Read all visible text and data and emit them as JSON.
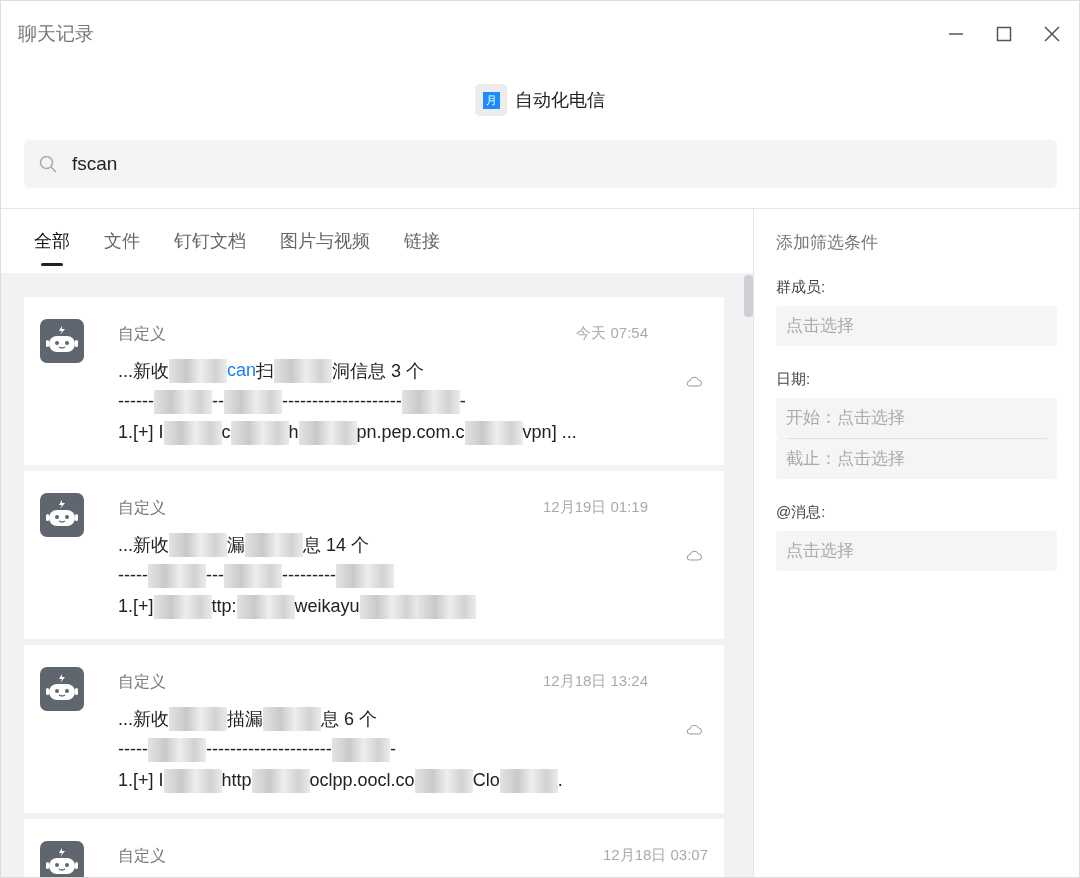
{
  "window": {
    "title": "聊天记录"
  },
  "chat": {
    "name": "自动化电信",
    "avatar_text": "月"
  },
  "search": {
    "value": "fscan"
  },
  "tabs": [
    {
      "label": "全部",
      "selected": true
    },
    {
      "label": "文件",
      "selected": false
    },
    {
      "label": "钉钉文档",
      "selected": false
    },
    {
      "label": "图片与视频",
      "selected": false
    },
    {
      "label": "链接",
      "selected": false
    }
  ],
  "results": [
    {
      "sender": "自定义",
      "time": "今天 07:54",
      "lines": [
        [
          {
            "kind": "text",
            "text": "...新收"
          },
          {
            "kind": "redacted"
          },
          {
            "kind": "match",
            "text": "can"
          },
          {
            "kind": "text",
            "text": "扫"
          },
          {
            "kind": "redacted"
          },
          {
            "kind": "text",
            "text": "洞信息 3 个"
          }
        ],
        [
          {
            "kind": "text",
            "text": "------"
          },
          {
            "kind": "redacted"
          },
          {
            "kind": "text",
            "text": "--"
          },
          {
            "kind": "redacted"
          },
          {
            "kind": "text",
            "text": "--------------------"
          },
          {
            "kind": "redacted"
          },
          {
            "kind": "text",
            "text": "-"
          }
        ],
        [
          {
            "kind": "text",
            "text": "1.[+] I"
          },
          {
            "kind": "redacted"
          },
          {
            "kind": "text",
            "text": "c"
          },
          {
            "kind": "redacted"
          },
          {
            "kind": "text",
            "text": "h"
          },
          {
            "kind": "redacted"
          },
          {
            "kind": "text",
            "text": "pn.pep.com.c"
          },
          {
            "kind": "redacted"
          },
          {
            "kind": "text",
            "text": "vpn] ..."
          }
        ]
      ]
    },
    {
      "sender": "自定义",
      "time": "12月19日 01:19",
      "lines": [
        [
          {
            "kind": "text",
            "text": "...新收"
          },
          {
            "kind": "redacted"
          },
          {
            "kind": "text",
            "text": "漏"
          },
          {
            "kind": "redacted"
          },
          {
            "kind": "text",
            "text": "息 14 个"
          }
        ],
        [
          {
            "kind": "text",
            "text": "-----"
          },
          {
            "kind": "redacted"
          },
          {
            "kind": "text",
            "text": "---"
          },
          {
            "kind": "redacted"
          },
          {
            "kind": "text",
            "text": "---------"
          },
          {
            "kind": "redacted"
          }
        ],
        [
          {
            "kind": "text",
            "text": "1.[+] "
          },
          {
            "kind": "redacted"
          },
          {
            "kind": "text",
            "text": "ttp:"
          },
          {
            "kind": "redacted"
          },
          {
            "kind": "text",
            "text": "weikayu"
          },
          {
            "kind": "redacted"
          },
          {
            "kind": "redacted"
          }
        ]
      ]
    },
    {
      "sender": "自定义",
      "time": "12月18日 13:24",
      "lines": [
        [
          {
            "kind": "text",
            "text": "...新收"
          },
          {
            "kind": "redacted"
          },
          {
            "kind": "text",
            "text": "描漏"
          },
          {
            "kind": "redacted"
          },
          {
            "kind": "text",
            "text": "息 6 个"
          }
        ],
        [
          {
            "kind": "text",
            "text": "-----"
          },
          {
            "kind": "redacted"
          },
          {
            "kind": "text",
            "text": "---------------------"
          },
          {
            "kind": "redacted"
          },
          {
            "kind": "text",
            "text": "-"
          }
        ],
        [
          {
            "kind": "text",
            "text": "1.[+] I"
          },
          {
            "kind": "redacted"
          },
          {
            "kind": "text",
            "text": "http"
          },
          {
            "kind": "redacted"
          },
          {
            "kind": "text",
            "text": "oclpp.oocl.co"
          },
          {
            "kind": "redacted"
          },
          {
            "kind": "text",
            "text": "Clo"
          },
          {
            "kind": "redacted"
          },
          {
            "kind": "text",
            "text": "."
          }
        ]
      ]
    },
    {
      "sender": "自定义",
      "time": "12月18日 03:07"
    }
  ],
  "filters": {
    "title": "添加筛选条件",
    "groups": [
      {
        "label": "群成员:",
        "fields": [
          {
            "placeholder": "点击选择"
          }
        ]
      },
      {
        "label": "日期:",
        "fields": [
          {
            "placeholder": "开始：点击选择"
          },
          {
            "placeholder": "截止：点击选择"
          }
        ]
      },
      {
        "label": "@消息:",
        "fields": [
          {
            "placeholder": "点击选择"
          }
        ]
      }
    ]
  }
}
